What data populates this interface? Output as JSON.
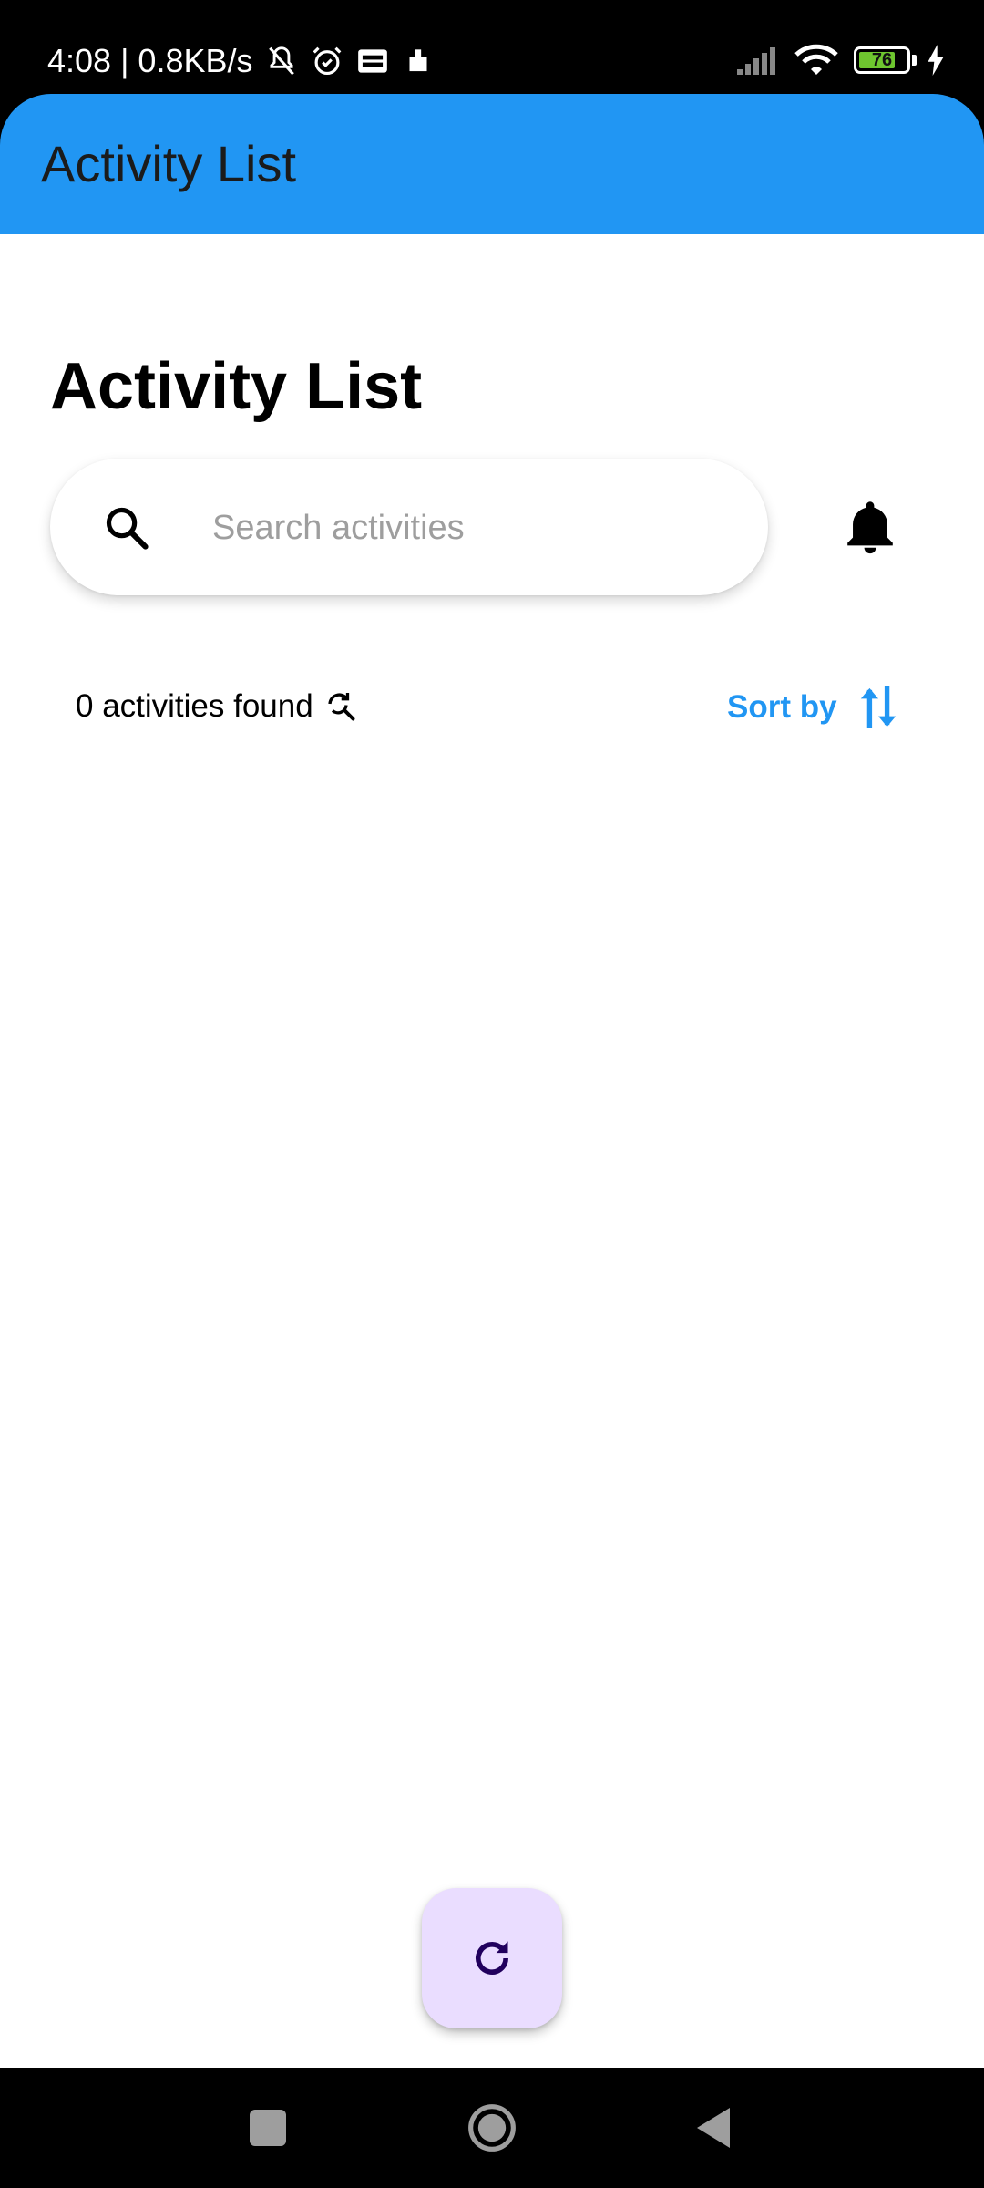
{
  "status_bar": {
    "time_speed": "4:08 | 0.8KB/s",
    "battery_level": "76",
    "icons": [
      "mute-icon",
      "alarm-icon",
      "webtoon-icon",
      "notification-icon",
      "signal-icon",
      "wifi-icon",
      "battery-icon",
      "charging-icon"
    ]
  },
  "app_bar": {
    "title": "Activity List",
    "color": "#2196f3"
  },
  "main": {
    "page_title": "Activity List",
    "search": {
      "placeholder": "Search activities",
      "value": ""
    },
    "results_text": "0 activities found",
    "sort_label": "Sort by",
    "accent_color": "#2196f3"
  },
  "fab": {
    "icon": "refresh-icon",
    "color": "#eaddff"
  },
  "nav_bar": {
    "buttons": [
      "recent-apps",
      "home",
      "back"
    ]
  }
}
